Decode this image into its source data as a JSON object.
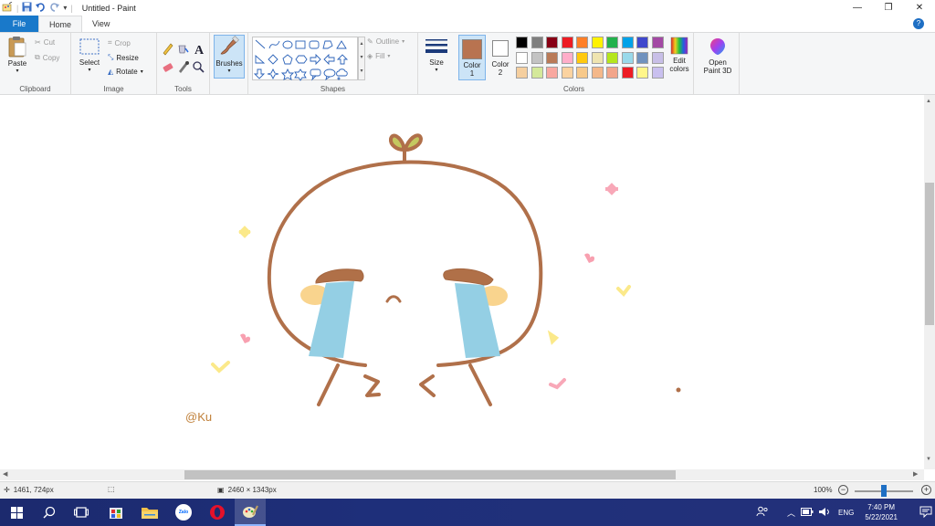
{
  "window": {
    "title": "Untitled - Paint",
    "minimize_glyph": "—",
    "restore_glyph": "❐",
    "close_glyph": "✕"
  },
  "quick_access": {
    "divider": "|",
    "dropdown_glyph": "▾"
  },
  "tabs": [
    {
      "label": "File"
    },
    {
      "label": "Home"
    },
    {
      "label": "View"
    }
  ],
  "help_glyph": "?",
  "ribbon": {
    "clipboard": {
      "paste": "Paste",
      "cut": "Cut",
      "copy": "Copy",
      "label": "Clipboard"
    },
    "image": {
      "select": "Select",
      "crop": "Crop",
      "resize": "Resize",
      "rotate": "Rotate",
      "label": "Image"
    },
    "tools": {
      "label": "Tools",
      "text_glyph": "A"
    },
    "brushes": {
      "label": "Brushes"
    },
    "shapes": {
      "outline": "Outline",
      "fill": "Fill",
      "label": "Shapes"
    },
    "size": {
      "label": "Size"
    },
    "colors": {
      "color1": "Color",
      "color1_num": "1",
      "color2": "Color",
      "color2_num": "2",
      "edit": "Edit",
      "edit2": "colors",
      "label": "Colors",
      "color1_value": "#b87350",
      "color2_value": "#ffffff",
      "palette_row1": [
        "#000000",
        "#7f7f7f",
        "#880015",
        "#ed1c24",
        "#ff7f27",
        "#fff200",
        "#22b14c",
        "#00a2e8",
        "#3f48cc",
        "#a349a4"
      ],
      "palette_row2": [
        "#ffffff",
        "#c3c3c3",
        "#b97a57",
        "#ffaec9",
        "#ffc90e",
        "#efe4b0",
        "#b5e61d",
        "#99d9ea",
        "#7092be",
        "#c8bfe7"
      ],
      "palette_row3": [
        "#f5cf9f",
        "#d4e99a",
        "#f8a8a0",
        "#fbd3a0",
        "#f7c98a",
        "#f4b88a",
        "#f2a58a",
        "#ed1c24",
        "#fff68a",
        "#c9c0ef"
      ]
    },
    "paint3d": {
      "line1": "Open",
      "line2": "Paint 3D"
    }
  },
  "drawing": {
    "signature": "@Ku"
  },
  "status": {
    "cursor_pos": "1461, 724px",
    "image_size": "2460 × 1343px",
    "zoom": "100%",
    "zoom_fraction": 0.5
  },
  "taskbar": {
    "language": "ENG",
    "time": "7:40 PM",
    "date": "5/22/2021",
    "zalo_label": "Zalo"
  }
}
